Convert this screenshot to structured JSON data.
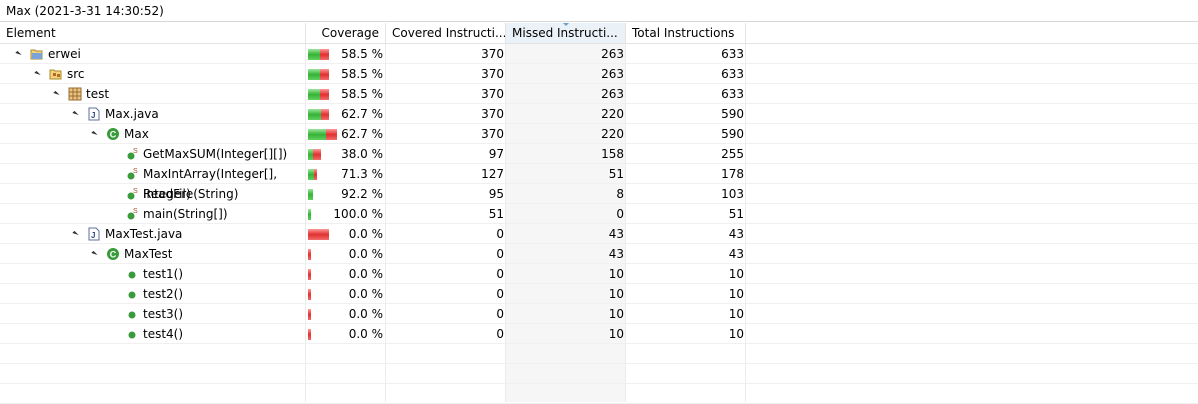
{
  "title": "Max (2021-3-31 14:30:52)",
  "columns": {
    "element": "Element",
    "coverage": "Coverage",
    "covered": "Covered Instructi...",
    "missed": "Missed Instructi...",
    "total": "Total Instructions"
  },
  "rows": [
    {
      "label": "erwei",
      "icon": "project-folder-icon",
      "level": 0,
      "expandable": true,
      "coverage": "58.5 %",
      "covered": "370",
      "missed": "263",
      "total": "633",
      "frac": 0.585
    },
    {
      "label": "src",
      "icon": "source-folder-icon",
      "level": 1,
      "expandable": true,
      "coverage": "58.5 %",
      "covered": "370",
      "missed": "263",
      "total": "633",
      "frac": 0.585
    },
    {
      "label": "test",
      "icon": "package-icon",
      "level": 2,
      "expandable": true,
      "coverage": "58.5 %",
      "covered": "370",
      "missed": "263",
      "total": "633",
      "frac": 0.585
    },
    {
      "label": "Max.java",
      "icon": "java-file-icon",
      "level": 3,
      "expandable": true,
      "coverage": "62.7 %",
      "covered": "370",
      "missed": "220",
      "total": "590",
      "frac": 0.627
    },
    {
      "label": "Max",
      "icon": "class-icon",
      "level": 4,
      "expandable": true,
      "coverage": "62.7 %",
      "covered": "370",
      "missed": "220",
      "total": "590",
      "frac": 0.627
    },
    {
      "label": "GetMaxSUM(Integer[][])",
      "icon": "static-method-icon",
      "level": 5,
      "expandable": false,
      "coverage": "38.0 %",
      "covered": "97",
      "missed": "158",
      "total": "255",
      "frac": 0.38
    },
    {
      "label": "MaxIntArray(Integer[], Integer)",
      "icon": "static-method-icon",
      "level": 5,
      "expandable": false,
      "coverage": "71.3 %",
      "covered": "127",
      "missed": "51",
      "total": "178",
      "frac": 0.713
    },
    {
      "label": "ReadFile(String)",
      "icon": "static-method-icon",
      "level": 5,
      "expandable": false,
      "coverage": "92.2 %",
      "covered": "95",
      "missed": "8",
      "total": "103",
      "frac": 0.922
    },
    {
      "label": "main(String[])",
      "icon": "static-method-icon",
      "level": 5,
      "expandable": false,
      "coverage": "100.0 %",
      "covered": "51",
      "missed": "0",
      "total": "51",
      "frac": 1.0
    },
    {
      "label": "MaxTest.java",
      "icon": "java-file-icon",
      "level": 3,
      "expandable": true,
      "coverage": "0.0 %",
      "covered": "0",
      "missed": "43",
      "total": "43",
      "frac": 0.0
    },
    {
      "label": "MaxTest",
      "icon": "class-icon",
      "level": 4,
      "expandable": true,
      "coverage": "0.0 %",
      "covered": "0",
      "missed": "43",
      "total": "43",
      "frac": 0.0
    },
    {
      "label": "test1()",
      "icon": "method-icon",
      "level": 5,
      "expandable": false,
      "coverage": "0.0 %",
      "covered": "0",
      "missed": "10",
      "total": "10",
      "frac": 0.0
    },
    {
      "label": "test2()",
      "icon": "method-icon",
      "level": 5,
      "expandable": false,
      "coverage": "0.0 %",
      "covered": "0",
      "missed": "10",
      "total": "10",
      "frac": 0.0
    },
    {
      "label": "test3()",
      "icon": "method-icon",
      "level": 5,
      "expandable": false,
      "coverage": "0.0 %",
      "covered": "0",
      "missed": "10",
      "total": "10",
      "frac": 0.0
    },
    {
      "label": "test4()",
      "icon": "method-icon",
      "level": 5,
      "expandable": false,
      "coverage": "0.0 %",
      "covered": "0",
      "missed": "10",
      "total": "10",
      "frac": 0.0
    }
  ],
  "colors": {
    "covered": "#36b336",
    "missed": "#e03030",
    "sorted_header": "#eaf2f8"
  }
}
